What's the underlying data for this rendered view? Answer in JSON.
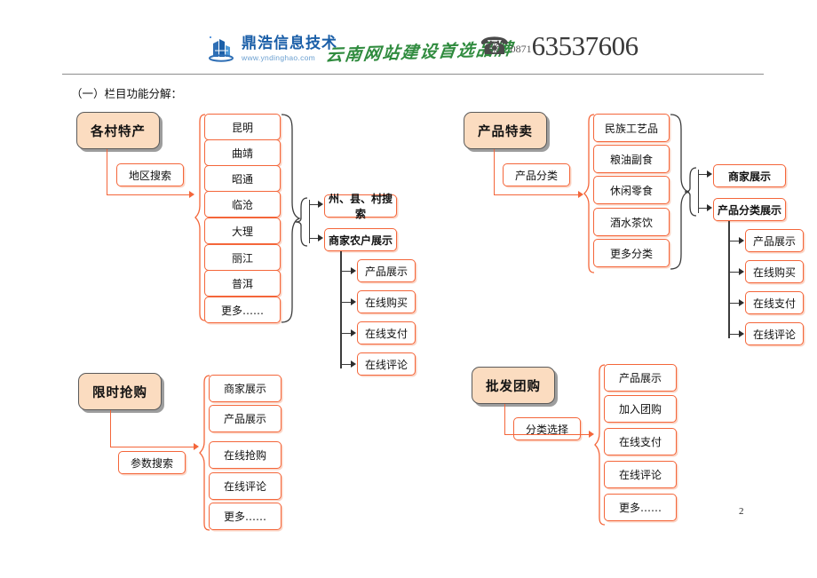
{
  "header": {
    "logo_icon": "building-logo-icon",
    "logo_name": "鼎浩信息技术",
    "logo_url": "www.yndinghao.com",
    "slogan": "云南网站建设首选品牌",
    "phone_icon": "telephone-icon",
    "phone_area_code": "0871",
    "phone_number": "63537606"
  },
  "section": {
    "title": "（一）栏目功能分解："
  },
  "page_number": "2",
  "clusters": [
    {
      "id": "cluster-village-specialty",
      "root": "各村特产",
      "filter": "地区搜索",
      "items": [
        "昆明",
        "曲靖",
        "昭通",
        "临沧",
        "大理",
        "丽江",
        "普洱",
        "更多……"
      ],
      "branches": [
        "州、县、村搜索",
        "商家农户展示"
      ],
      "leaves": [
        "产品展示",
        "在线购买",
        "在线支付",
        "在线评论"
      ]
    },
    {
      "id": "cluster-product-sale",
      "root": "产品特卖",
      "filter": "产品分类",
      "items": [
        "民族工艺品",
        "粮油副食",
        "休闲零食",
        "酒水茶饮",
        "更多分类"
      ],
      "branches": [
        "商家展示",
        "产品分类展示"
      ],
      "leaves": [
        "产品展示",
        "在线购买",
        "在线支付",
        "在线评论"
      ]
    },
    {
      "id": "cluster-flash-sale",
      "root": "限时抢购",
      "filter": "参数搜索",
      "items": [
        "商家展示",
        "产品展示",
        "在线抢购",
        "在线评论",
        "更多……"
      ],
      "branches": [],
      "leaves": []
    },
    {
      "id": "cluster-group-buy",
      "root": "批发团购",
      "filter": "分类选择",
      "items": [
        "产品展示",
        "加入团购",
        "在线支付",
        "在线评论",
        "更多……"
      ],
      "branches": [],
      "leaves": []
    }
  ]
}
